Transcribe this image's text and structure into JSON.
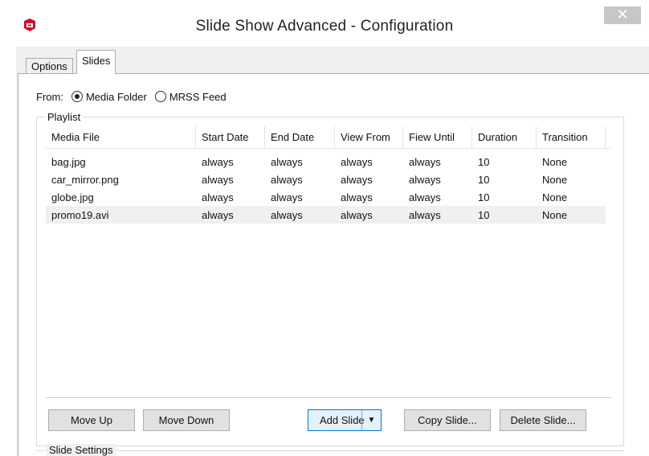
{
  "window": {
    "title": "Slide Show Advanced - Configuration",
    "close_symbol": "✕",
    "icon": "app-shield-icon",
    "icon_color": "#c8102e"
  },
  "tabs": [
    {
      "label": "Options",
      "active": false
    },
    {
      "label": "Slides",
      "active": true
    }
  ],
  "source": {
    "label": "From:",
    "options": [
      {
        "label": "Media Folder",
        "checked": true
      },
      {
        "label": "MRSS Feed",
        "checked": false
      }
    ]
  },
  "playlist": {
    "label": "Playlist",
    "columns": [
      "Media File",
      "Start Date",
      "End Date",
      "View From",
      "Fiew Until",
      "Duration",
      "Transition"
    ],
    "rows": [
      [
        "bag.jpg",
        "always",
        "always",
        "always",
        "always",
        "10",
        "None"
      ],
      [
        "car_mirror.png",
        "always",
        "always",
        "always",
        "always",
        "10",
        "None"
      ],
      [
        "globe.jpg",
        "always",
        "always",
        "always",
        "always",
        "10",
        "None"
      ],
      [
        "promo19.avi",
        "always",
        "always",
        "always",
        "always",
        "10",
        "None"
      ]
    ],
    "selected_row": 3
  },
  "buttons": {
    "move_up": "Move Up",
    "move_down": "Move Down",
    "add_slide": "Add Slide",
    "add_slide_arrow": "▼",
    "copy_slide": "Copy Slide...",
    "delete_slide": "Delete Slide..."
  },
  "slide_settings": {
    "label": "Slide Settings"
  }
}
